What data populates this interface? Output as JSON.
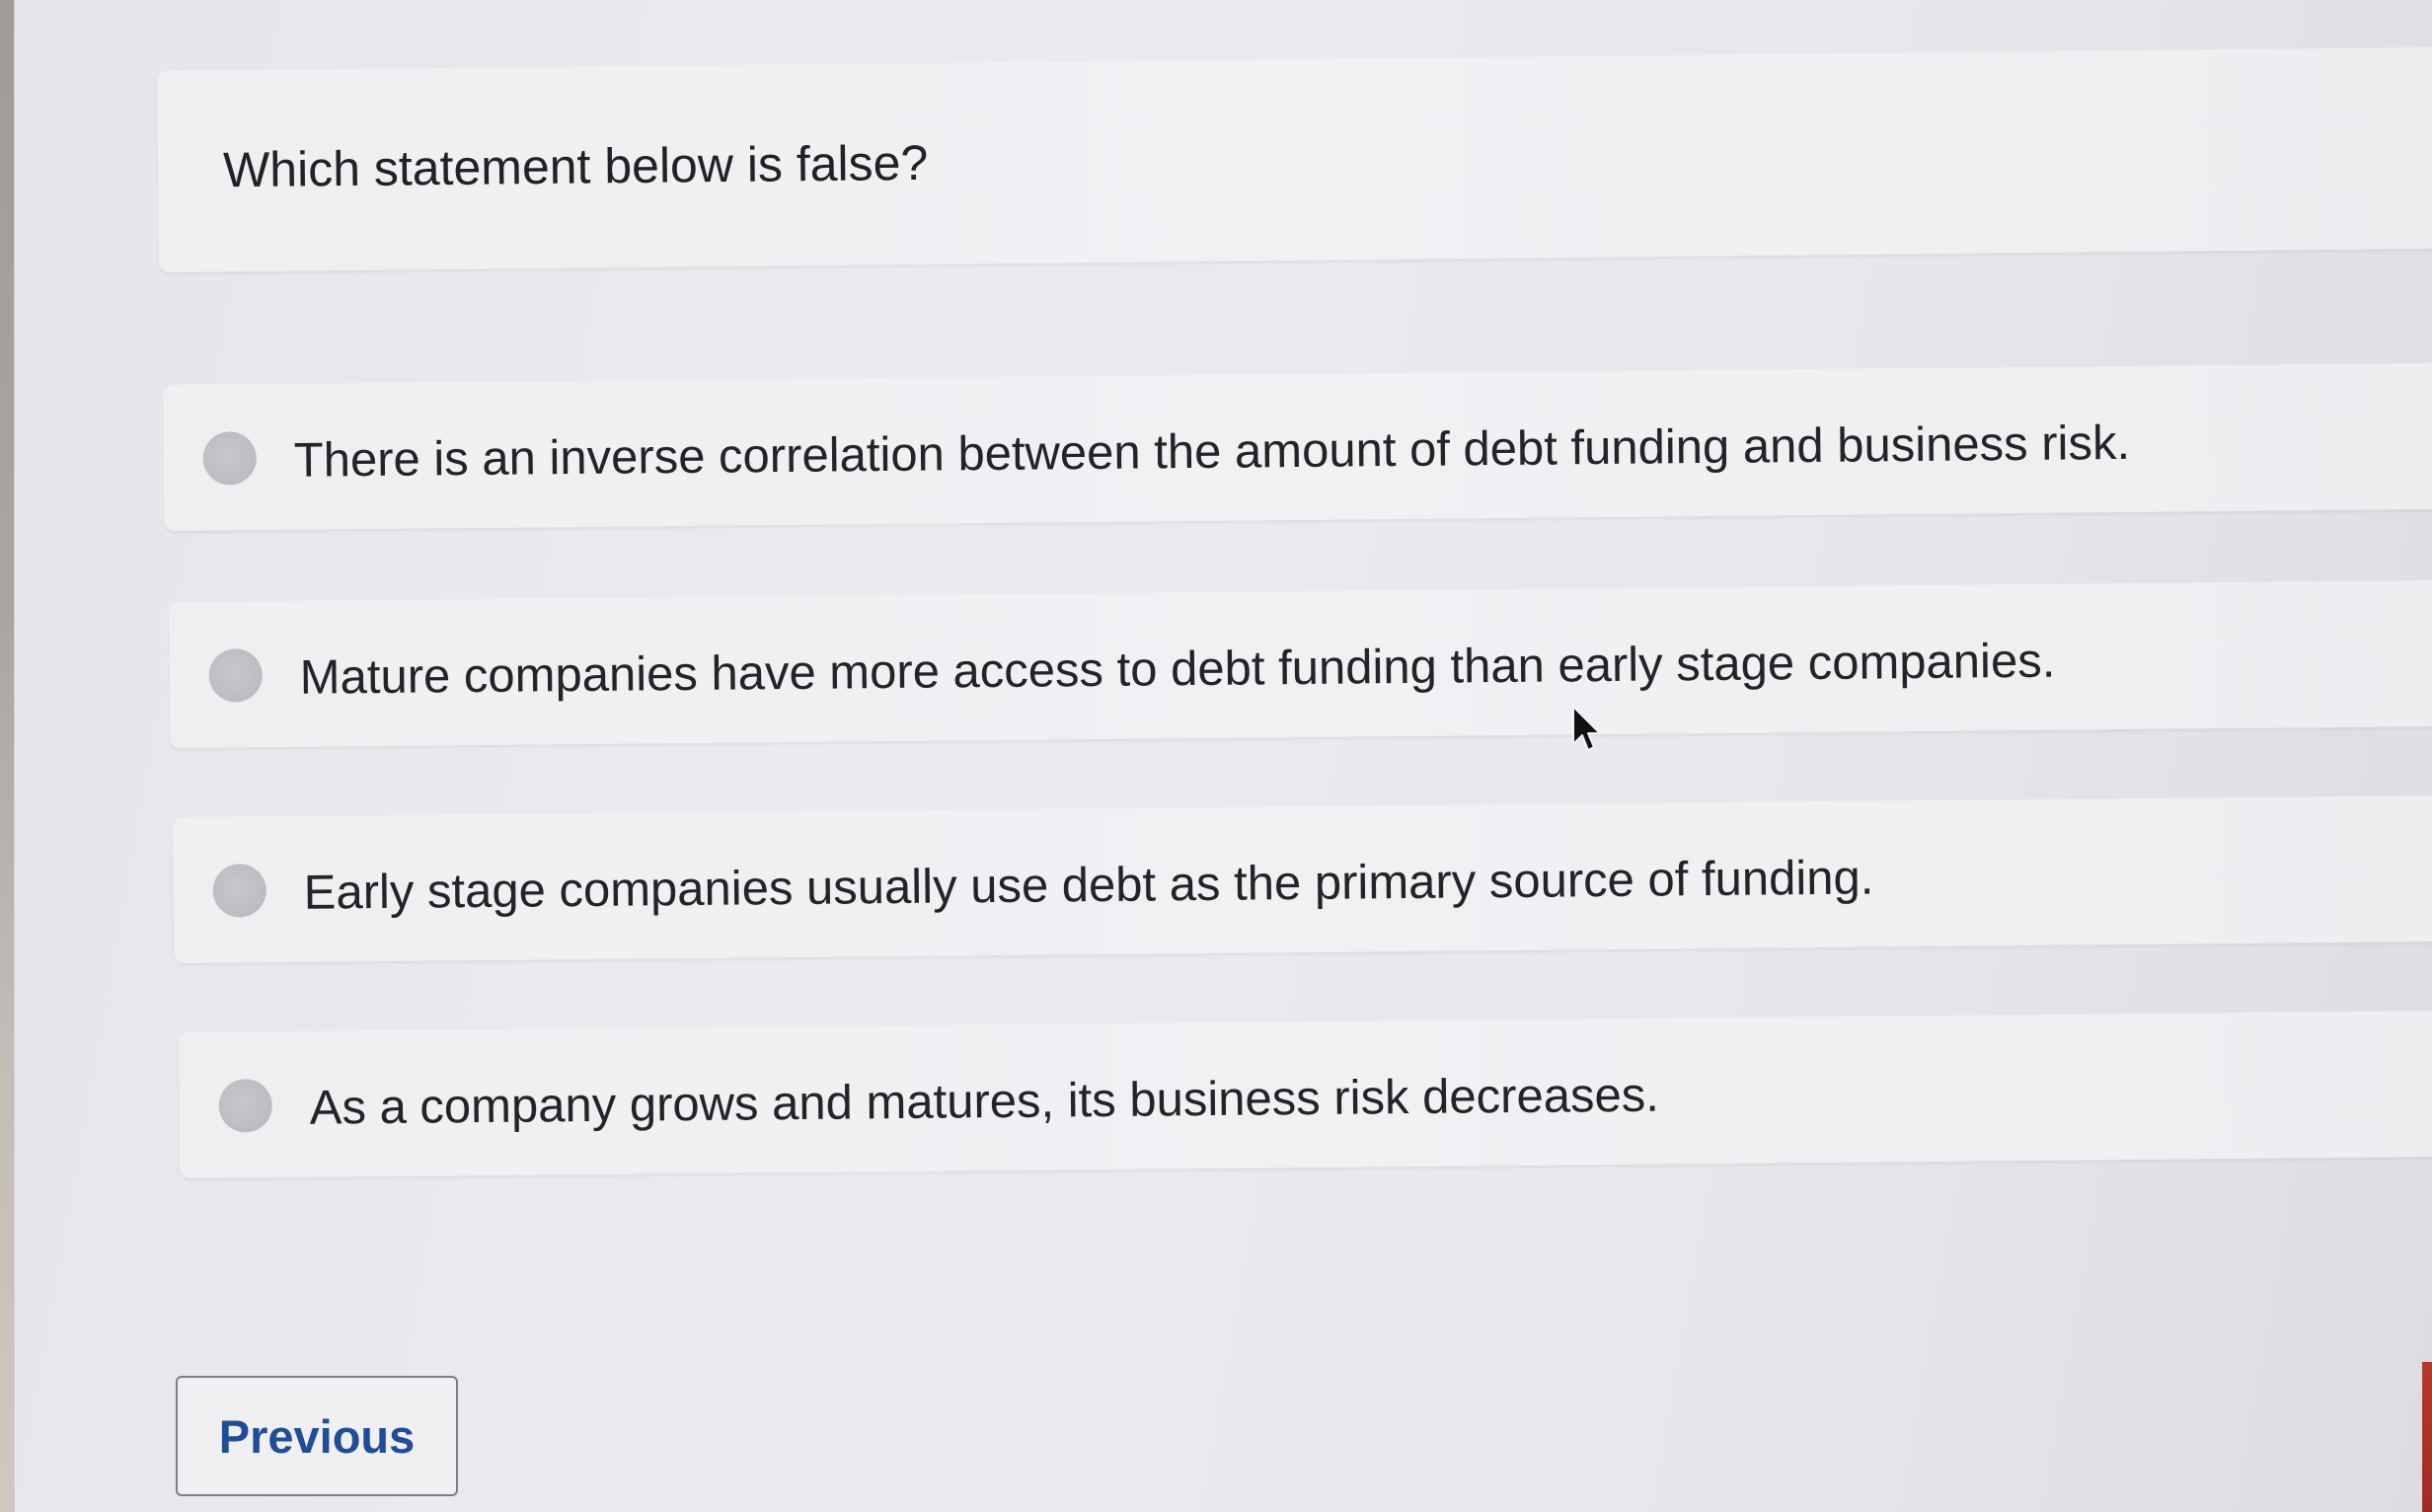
{
  "question": {
    "text": "Which statement below is false?"
  },
  "options": [
    {
      "label": "There is an inverse correlation between the amount of debt funding and business risk."
    },
    {
      "label": "Mature companies have more access to debt funding than early stage companies."
    },
    {
      "label": "Early stage companies usually use debt as the primary source of funding."
    },
    {
      "label": "As a company grows and matures, its business risk decreases."
    }
  ],
  "navigation": {
    "previous_label": "Previous"
  },
  "colors": {
    "button_text": "#1f4e99",
    "radio_fill": "#bdbdc2",
    "card_background": "#f0f0f3"
  },
  "icons": {
    "cursor": "mouse-pointer-icon"
  }
}
